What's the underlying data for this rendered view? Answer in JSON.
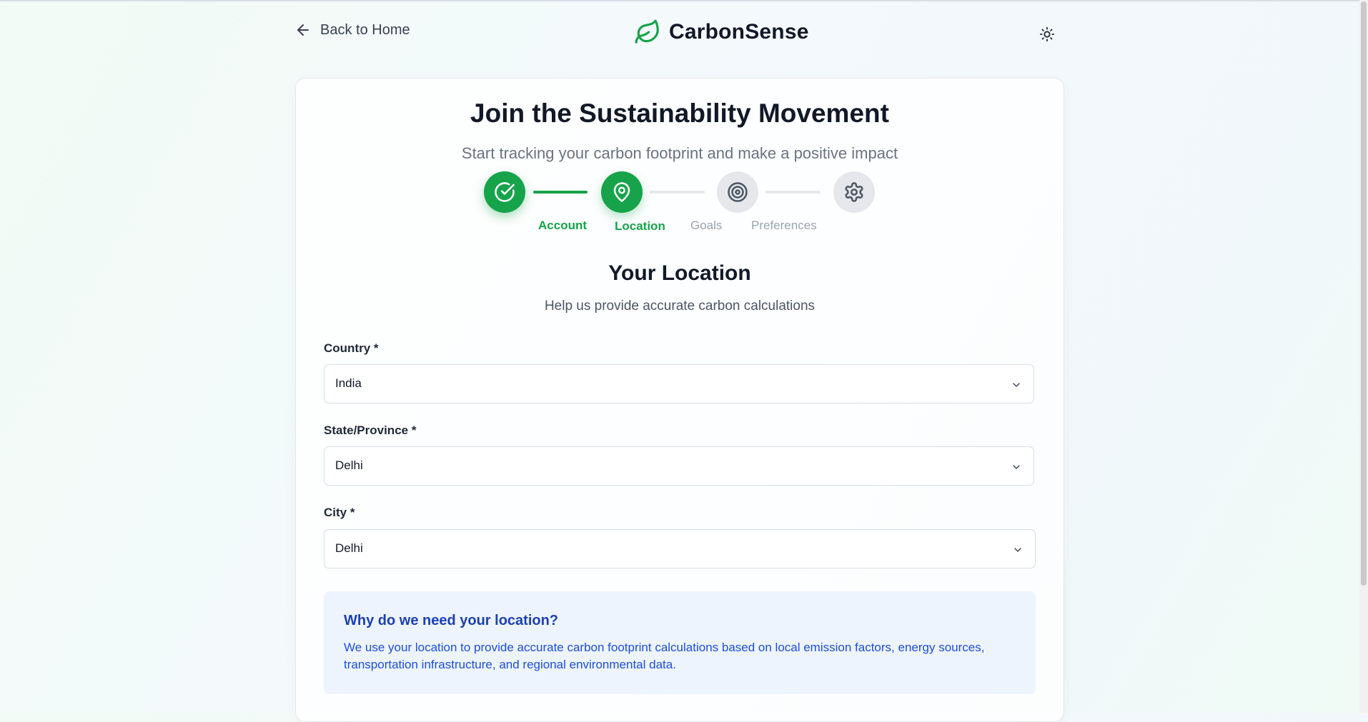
{
  "header": {
    "back_label": "Back to Home",
    "brand_name": "CarbonSense"
  },
  "card": {
    "title": "Join the Sustainability Movement",
    "subtitle": "Start tracking your carbon footprint and make a positive impact"
  },
  "steps": [
    {
      "label": "Account",
      "icon": "check-circle-icon",
      "status": "completed"
    },
    {
      "label": "Location",
      "icon": "map-pin-icon",
      "status": "current"
    },
    {
      "label": "Goals",
      "icon": "target-icon",
      "status": "pending"
    },
    {
      "label": "Preferences",
      "icon": "gear-icon",
      "status": "pending"
    }
  ],
  "section": {
    "title": "Your Location",
    "description": "Help us provide accurate carbon calculations"
  },
  "fields": {
    "country": {
      "label": "Country *",
      "value": "India"
    },
    "state": {
      "label": "State/Province *",
      "value": "Delhi"
    },
    "city": {
      "label": "City *",
      "value": "Delhi"
    }
  },
  "info": {
    "title": "Why do we need your location?",
    "text": "We use your location to provide accurate carbon footprint calculations based on local emission factors, energy sources, transportation infrastructure, and regional environmental data."
  },
  "colors": {
    "brand_green": "#16a34a",
    "info_blue": "#1d4ed8",
    "info_bg": "#edf4fe",
    "pending_gray": "#e5e7eb"
  }
}
